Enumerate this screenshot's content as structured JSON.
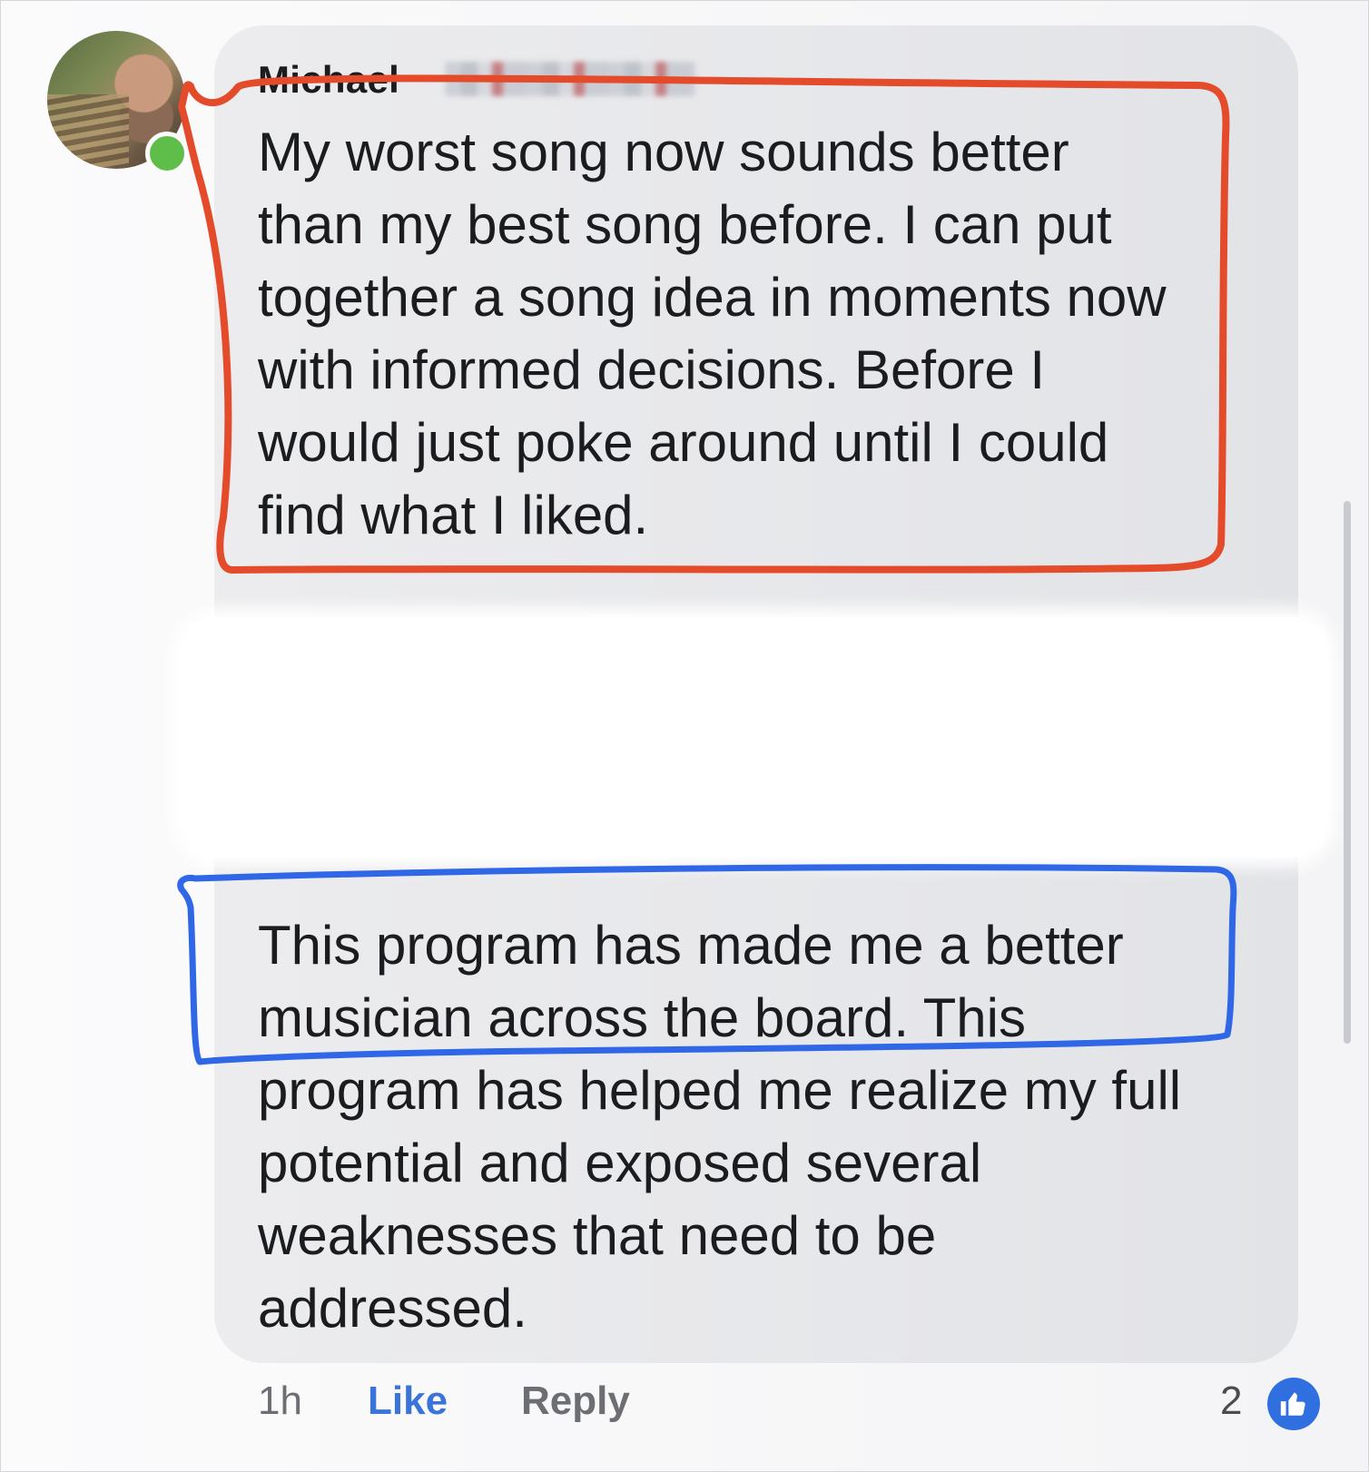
{
  "comment": {
    "author": "Michael",
    "online": true,
    "text_part1": "My worst song now sounds better\nthan my best song before. I can put\ntogether a song idea in moments now\nwith informed decisions. Before I\nwould just poke around until I could\nfind what I liked.",
    "text_part2": "This program has made me a better\nmusician across the board. This\nprogram has helped me realize my full\npotential and exposed several\nweaknesses that need to be\naddressed."
  },
  "footer": {
    "time": "1h",
    "like_label": "Like",
    "reply_label": "Reply",
    "reaction_count": "2"
  },
  "colors": {
    "annotation_red": "#e34b2b",
    "annotation_blue": "#2f67e6",
    "like_blue": "#3a74d8"
  },
  "icons": [
    "avatar",
    "online-status-icon",
    "like-reaction-icon"
  ]
}
